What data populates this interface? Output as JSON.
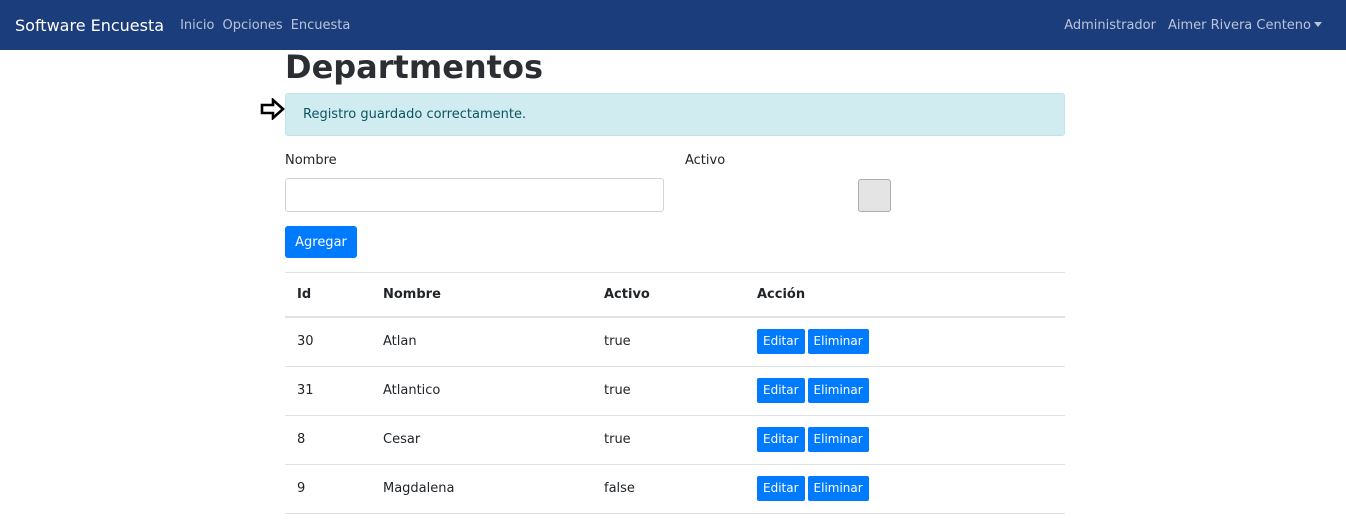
{
  "navbar": {
    "brand": "Software Encuesta",
    "links": [
      "Inicio",
      "Opciones",
      "Encuesta"
    ],
    "role": "Administrador",
    "user": "Aimer Rivera Centeno"
  },
  "page": {
    "title": "Departmentos",
    "alert": "Registro guardado correctamente."
  },
  "form": {
    "nombre_label": "Nombre",
    "nombre_value": "",
    "activo_label": "Activo",
    "agregar_label": "Agregar"
  },
  "table": {
    "headers": [
      "Id",
      "Nombre",
      "Activo",
      "Acción"
    ],
    "rows": [
      {
        "id": "30",
        "nombre": "Atlan",
        "activo": "true"
      },
      {
        "id": "31",
        "nombre": "Atlantico",
        "activo": "true"
      },
      {
        "id": "8",
        "nombre": "Cesar",
        "activo": "true"
      },
      {
        "id": "9",
        "nombre": "Magdalena",
        "activo": "false"
      }
    ],
    "edit_label": "Editar",
    "delete_label": "Eliminar"
  },
  "colors": {
    "navbar": "#1c3d7c",
    "primary": "#007bff",
    "alert_bg": "#d1ecf1",
    "alert_text": "#0c5460"
  }
}
